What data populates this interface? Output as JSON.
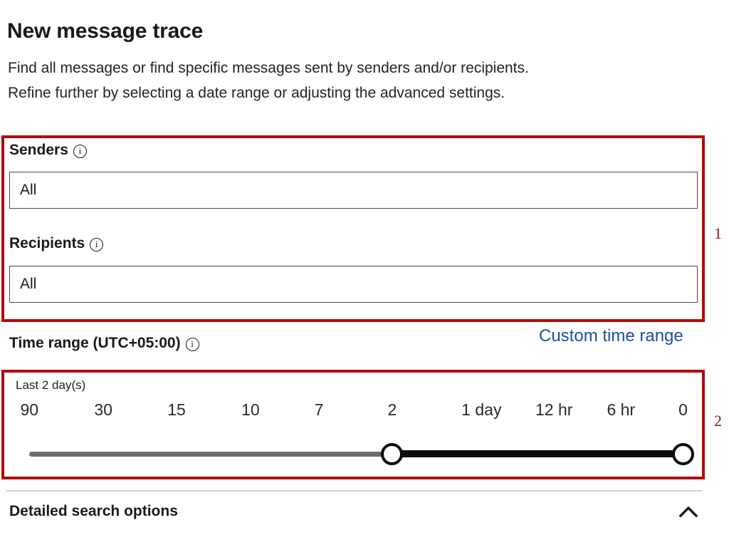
{
  "header": {
    "title": "New message trace",
    "description_line1": "Find all messages or find specific messages sent by senders and/or recipients.",
    "description_line2": "Refine further by selecting a date range or adjusting the advanced settings."
  },
  "annotations": [
    {
      "number": "1"
    },
    {
      "number": "2"
    }
  ],
  "senders": {
    "label": "Senders",
    "info_icon": "info-icon",
    "value": "All",
    "placeholder": "All"
  },
  "recipients": {
    "label": "Recipients",
    "info_icon": "info-icon",
    "value": "All",
    "placeholder": "All"
  },
  "time_range": {
    "label": "Time range (UTC+05:00)",
    "info_icon": "info-icon",
    "custom_link": "Custom time range",
    "custom_link_color": "#1f4e9c",
    "caption": "Last 2 day(s)",
    "ticks": [
      {
        "label": "90",
        "pos": 3.6
      },
      {
        "label": "30",
        "pos": 14.2
      },
      {
        "label": "15",
        "pos": 24.7
      },
      {
        "label": "10",
        "pos": 35.3
      },
      {
        "label": "7",
        "pos": 45.1
      },
      {
        "label": "2",
        "pos": 55.6
      },
      {
        "label": "1 day",
        "pos": 68.4
      },
      {
        "label": "12 hr",
        "pos": 78.8
      },
      {
        "label": "6 hr",
        "pos": 88.4
      },
      {
        "label": "0",
        "pos": 97.3
      }
    ],
    "handle_left_pos": 55.6,
    "handle_right_pos": 97.3,
    "track_color_inactive": "#6d6d6d",
    "track_color_active": "#0b0b0b"
  },
  "detailed_search": {
    "label": "Detailed search options",
    "chevron_icon": "chevron-up-icon"
  }
}
